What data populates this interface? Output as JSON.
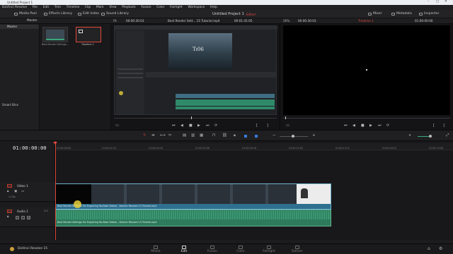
{
  "window": {
    "title": "Untitled Project 1"
  },
  "menu": [
    "DaVinci Resolve",
    "File",
    "Edit",
    "Trim",
    "Timeline",
    "Clip",
    "Mark",
    "View",
    "Playback",
    "Fusion",
    "Color",
    "Fairlight",
    "Workspace",
    "Help"
  ],
  "toolbar": {
    "media_pool": "Media Pool",
    "effects_library": "Effects Library",
    "edit_index": "Edit Index",
    "sound_library": "Sound Library",
    "project_title": "Untitled Project 1",
    "edited_badge": "Edited",
    "mixer": "Mixer",
    "metadata": "Metadata",
    "inspector": "Inspector"
  },
  "subbar": {
    "bin_name": "Master",
    "source_zoom": "Fit",
    "source_tc": "00:00:30:03",
    "source_clip": "Best Render Sett... 15 Tutorial.mp4",
    "source_dur": "00:01:41:05",
    "record_zoom": "26%",
    "record_tc": "00:00:30:03",
    "timeline_name": "Timeline 1",
    "record_tc_right": "01:00:00:00"
  },
  "bins": {
    "master": "Master",
    "smart_bins": "Smart Bins"
  },
  "pool": {
    "items": [
      {
        "label": "Best Render Settings..."
      },
      {
        "label": "Timeline 1"
      }
    ]
  },
  "source_video": {
    "title_text": "Tı06"
  },
  "timeline": {
    "timecode": "01:00:00:00",
    "ruler_ticks": [
      "01:00:00:00",
      "01:00:02:10",
      "01:00:04:20",
      "01:00:07:06",
      "01:00:09:16",
      "01:00:12:02",
      "01:00:14:12",
      "01:00:16:22",
      "01:00:19:08"
    ],
    "video_track": {
      "tag": "V1",
      "name": "Video 1",
      "clip_count": "1 Clip"
    },
    "audio_track": {
      "tag": "A1",
      "name": "Audio 1",
      "level": "2.0",
      "btn_r": "R",
      "btn_s": "S",
      "btn_m": "M"
    },
    "video_clip_label": "Best Render Settings For Exporting YouTube Videos - Davinci Resolve 15 Tutorial.mp4",
    "audio_clip_label": "Best Render Settings For Exporting YouTube Videos - Davinci Resolve 15 Tutorial.mp4"
  },
  "app_badge": "DaVinci Resolve 15",
  "pages": [
    "Media",
    "Edit",
    "Fusion",
    "Color",
    "Fairlight",
    "Deliver"
  ],
  "active_page": "Edit",
  "colors": {
    "accent_red": "#e0483a",
    "video_clip": "#2f6f8f",
    "audio_clip": "#2e7a5c",
    "playhead": "#e0483a"
  }
}
